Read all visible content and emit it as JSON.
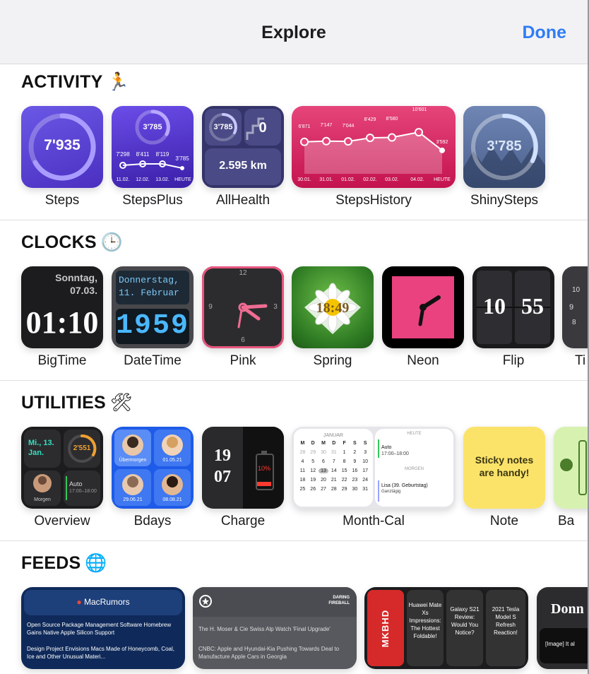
{
  "header": {
    "title": "Explore",
    "done_label": "Done"
  },
  "sections": {
    "activity": {
      "title": "ACTIVITY",
      "emoji": "🏃"
    },
    "clocks": {
      "title": "CLOCKS",
      "emoji": "🕒"
    },
    "utilities": {
      "title": "UTILITIES",
      "emoji": "🛠"
    },
    "feeds": {
      "title": "FEEDS",
      "emoji": "🌐"
    }
  },
  "activity": {
    "steps": {
      "label": "Steps",
      "value": "7'935"
    },
    "stepsplus": {
      "label": "StepsPlus",
      "value": "3'785",
      "points": [
        "7'298",
        "8'411",
        "8'119",
        "3'785"
      ],
      "dates": [
        "11.02.",
        "12.02.",
        "13.02.",
        "HEUTE"
      ]
    },
    "allhealth": {
      "label": "AllHealth",
      "steps": "3'785",
      "flights": "0",
      "distance": "2.595 km"
    },
    "stepshistory": {
      "label": "StepsHistory",
      "values": [
        "6'871",
        "7'147",
        "7'044",
        "8'429",
        "8'580",
        "10'601",
        "3'592"
      ],
      "dates": [
        "30.01.",
        "31.01.",
        "01.02.",
        "02.02.",
        "03.02.",
        "04.02.",
        "HEUTE"
      ]
    },
    "shinysteps": {
      "label": "ShinySteps",
      "value": "3'785"
    }
  },
  "clocks": {
    "bigtime": {
      "label": "BigTime",
      "day": "Sonntag,",
      "date": "07.03.",
      "time": "01:10"
    },
    "datetime": {
      "label": "DateTime",
      "line1": "Donnerstag,",
      "line2": "11. Februar",
      "time": "1959"
    },
    "pink": {
      "label": "Pink",
      "n12": "12",
      "n3": "3",
      "n6": "6",
      "n9": "9"
    },
    "spring": {
      "label": "Spring",
      "time": "18:49"
    },
    "neon": {
      "label": "Neon"
    },
    "flip": {
      "label": "Flip",
      "hour": "10",
      "minute": "55"
    },
    "ti": {
      "label": "Ti",
      "n10": "10",
      "n9": "9",
      "n8": "8"
    }
  },
  "utilities": {
    "overview": {
      "label": "Overview",
      "date": "Mi., 13. Jan.",
      "steps": "2'551",
      "person_caption": "Morgen",
      "event_title": "Auto",
      "event_time": "17:00–18:00"
    },
    "bdays": {
      "label": "Bdays",
      "people": [
        "Übermorgen",
        "01.05.21",
        "29.06.21",
        "08.08.21"
      ]
    },
    "charge": {
      "label": "Charge",
      "hour": "19",
      "minute": "07",
      "battery": "10%"
    },
    "monthcal": {
      "label": "Month-Cal",
      "month": "JANUAR",
      "weekdays": [
        "M",
        "D",
        "M",
        "D",
        "F",
        "S",
        "S"
      ],
      "rows": [
        [
          "28",
          "29",
          "30",
          "31",
          "1",
          "2",
          "3"
        ],
        [
          "4",
          "5",
          "6",
          "7",
          "8",
          "9",
          "10"
        ],
        [
          "11",
          "12",
          "13",
          "14",
          "15",
          "16",
          "17"
        ],
        [
          "18",
          "19",
          "20",
          "21",
          "22",
          "23",
          "24"
        ],
        [
          "25",
          "26",
          "27",
          "28",
          "29",
          "30",
          "31"
        ]
      ],
      "today_header": "HEUTE",
      "event1_title": "Auto",
      "event1_time": "17:00–18:00",
      "tomorrow_header": "MORGEN",
      "event2_title": "Lisa (39. Geburtstag)",
      "event2_time": "Ganztägig"
    },
    "note": {
      "label": "Note",
      "text": "Sticky notes are handy!"
    },
    "battery": {
      "label": "Ba"
    }
  },
  "feeds": {
    "macrumors": {
      "source": "MacRumors",
      "h1": "Open Source Package Management Software Homebrew Gains Native Apple Silicon Support",
      "h2": "Design Project Envisions Macs Made of Honeycomb, Coal, Ice and Other Unusual Materi..."
    },
    "daringfireball": {
      "source_line1": "DARING",
      "source_line2": "FIREBALL",
      "h1": "The H. Moser & Cie Swiss Alp Watch 'Final Upgrade'",
      "h2": "CNBC: Apple and Hyundai-Kia Pushing Towards Deal to Manufacture Apple Cars in Georgia"
    },
    "mkbhd": {
      "logo": "MKBHD",
      "v1": "Huawei Mate Xs Impressions: The Hottest Foldable!",
      "v2": "Galaxy S21 Review: Would You Notice?",
      "v3": "2021 Tesla Model S Refresh Reaction!"
    },
    "donn": {
      "title": "Donn",
      "text": "[Image] It al"
    }
  }
}
